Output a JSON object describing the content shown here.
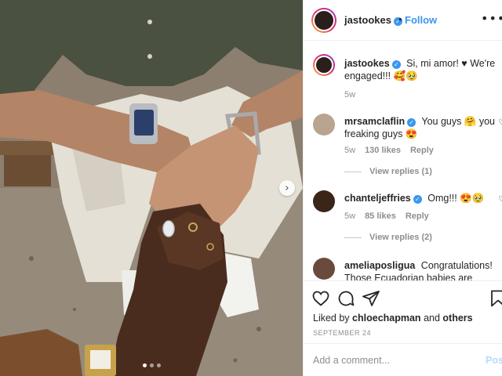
{
  "post": {
    "author": "jastookes",
    "follow_label": "Follow",
    "bullet": "•",
    "more_icon": "more-options-icon",
    "photo_alt": "Engagement photo: two hands holding, diamond ring, wristwatches",
    "carousel": {
      "total": 3,
      "current": 1
    }
  },
  "caption": {
    "username": "jastookes",
    "text": "Si, mi amor! ♥ We're engaged!!! 🥰🥹",
    "time": "5w"
  },
  "comments": [
    {
      "username": "mrsamclaflin",
      "verified": true,
      "text": "You guys 🤗 you freaking guys 😍",
      "time": "5w",
      "likes": "130 likes",
      "reply_label": "Reply",
      "view_replies": "View replies (1)"
    },
    {
      "username": "chanteljeffries",
      "verified": true,
      "text": "Omg!!! 😍🥹",
      "time": "5w",
      "likes": "85 likes",
      "reply_label": "Reply",
      "view_replies": "View replies (2)"
    },
    {
      "username": "ameliaposligua",
      "verified": false,
      "text": "Congratulations! Those Ecuadorian babies are going",
      "time": "",
      "likes": "",
      "reply_label": "",
      "view_replies": ""
    }
  ],
  "actions": {
    "like_icon": "heart-icon",
    "comment_icon": "comment-icon",
    "share_icon": "share-icon",
    "save_icon": "bookmark-icon",
    "liked_by_prefix": "Liked by",
    "liked_by_user": "chloechapman",
    "liked_by_and": "and",
    "liked_by_others": "others",
    "date": "SEPTEMBER 24"
  },
  "add_comment": {
    "placeholder": "Add a comment...",
    "post_label": "Post"
  },
  "colors": {
    "accent": "#3897f0",
    "text": "#262626",
    "muted": "#8e8e8e",
    "post_disabled": "#b3dbff"
  }
}
